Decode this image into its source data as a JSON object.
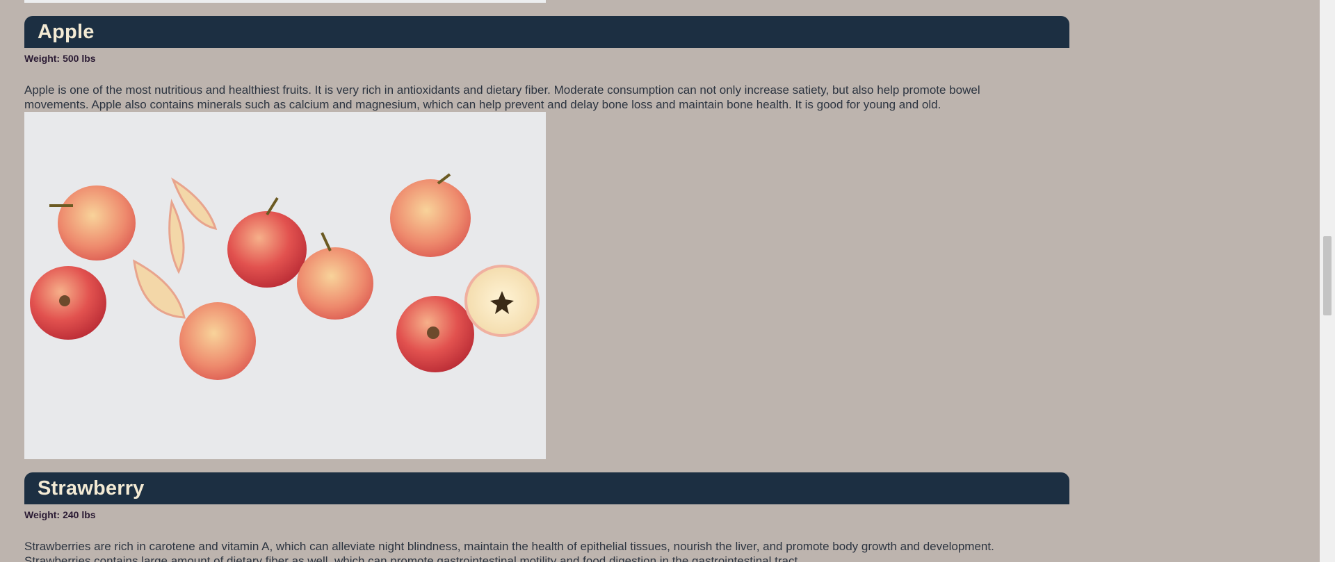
{
  "fruits": [
    {
      "name": "Apple",
      "weight_label": "Weight:",
      "weight_value": "500 lbs",
      "description": "Apple is one of the most nutritious and healthiest fruits. It is very rich in antioxidants and dietary fiber. Moderate consumption can not only increase satiety, but also help promote bowel movements. Apple also contains minerals such as calcium and magnesium, which can help prevent and delay bone loss and maintain bone health. It is good for young and old."
    },
    {
      "name": "Strawberry",
      "weight_label": "Weight:",
      "weight_value": "240 lbs",
      "description": "Strawberries are rich in carotene and vitamin A, which can alleviate night blindness, maintain the health of epithelial tissues, nourish the liver, and promote body growth and development. Strawberries contains large amount of dietary fiber as well, which can promote gastrointestinal motility and food digestion in the gastrointestinal tract."
    }
  ],
  "colors": {
    "page_background": "#bdb4ae",
    "header_background": "#1c2f42",
    "header_text": "#f3ead4",
    "body_text": "#2c3440"
  }
}
